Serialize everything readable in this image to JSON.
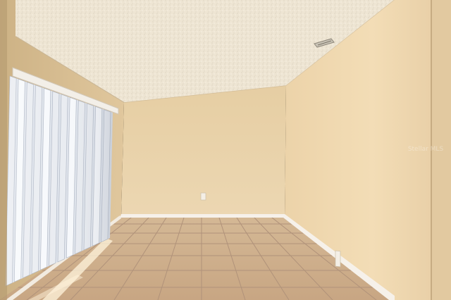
{
  "photo": {
    "subject": "empty-room-interior",
    "elements": [
      "textured-ceiling",
      "ceiling-vent",
      "beige-walls",
      "vertical-blinds",
      "ceramic-tile-floor",
      "baseboards",
      "wall-outlet",
      "sunlight-patch"
    ],
    "colors": {
      "ceiling": "#eee4d0",
      "wall_back": "#e7d2aa",
      "wall_left": "#dcc298",
      "wall_right": "#f0dbb6",
      "floor_tile": "#cdae8c",
      "grout": "#b0927a",
      "baseboard": "#f6f1ea",
      "blinds": "#e9ecf1"
    }
  },
  "watermark": {
    "text": "Stellar MLS",
    "reproduced_as_picture": true
  }
}
